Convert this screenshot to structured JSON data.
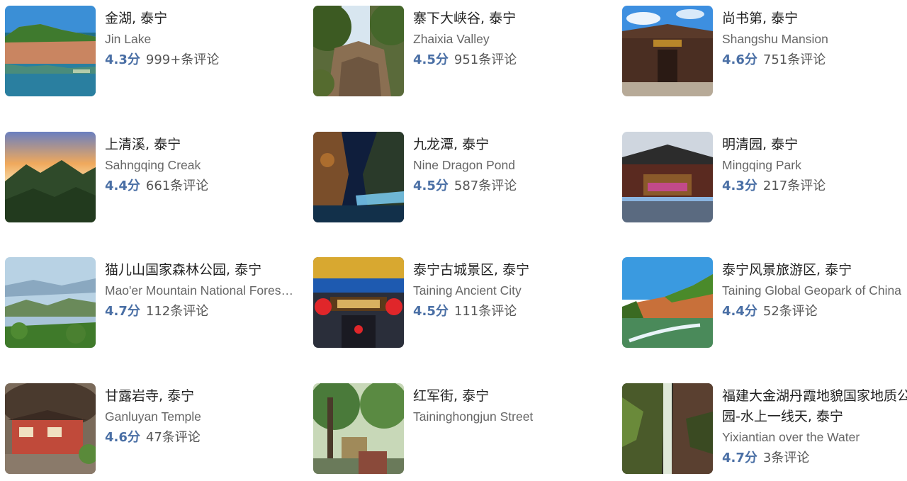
{
  "cards": [
    {
      "name_zh": "金湖, 泰宁",
      "name_en": "Jin Lake",
      "score": "4.3分",
      "reviews": "999+条评论"
    },
    {
      "name_zh": "寨下大峡谷, 泰宁",
      "name_en": "Zhaixia Valley",
      "score": "4.5分",
      "reviews": "951条评论"
    },
    {
      "name_zh": "尚书第, 泰宁",
      "name_en": "Shangshu Mansion",
      "score": "4.6分",
      "reviews": "751条评论"
    },
    {
      "name_zh": "上清溪, 泰宁",
      "name_en": "Sahngqing Creak",
      "score": "4.4分",
      "reviews": "661条评论"
    },
    {
      "name_zh": "九龙潭, 泰宁",
      "name_en": "Nine Dragon Pond",
      "score": "4.5分",
      "reviews": "587条评论"
    },
    {
      "name_zh": "明清园, 泰宁",
      "name_en": "Mingqing Park",
      "score": "4.3分",
      "reviews": "217条评论"
    },
    {
      "name_zh": "猫儿山国家森林公园, 泰宁",
      "name_en": "Mao'er Mountain National Forest Park",
      "score": "4.7分",
      "reviews": "112条评论"
    },
    {
      "name_zh": "泰宁古城景区, 泰宁",
      "name_en": "Taining Ancient City",
      "score": "4.5分",
      "reviews": "111条评论"
    },
    {
      "name_zh": "泰宁风景旅游区, 泰宁",
      "name_en": "Taining Global Geopark of China",
      "score": "4.4分",
      "reviews": "52条评论"
    },
    {
      "name_zh": "甘露岩寺, 泰宁",
      "name_en": "Ganluyan Temple",
      "score": "4.6分",
      "reviews": "47条评论"
    },
    {
      "name_zh": "红军街, 泰宁",
      "name_en": "Taininghongjun Street",
      "score": "",
      "reviews": ""
    },
    {
      "name_zh": "福建大金湖丹霞地貌国家地质公园-水上一线天, 泰宁",
      "name_en": "Yixiantian over the Water",
      "score": "4.7分",
      "reviews": "3条评论"
    }
  ]
}
